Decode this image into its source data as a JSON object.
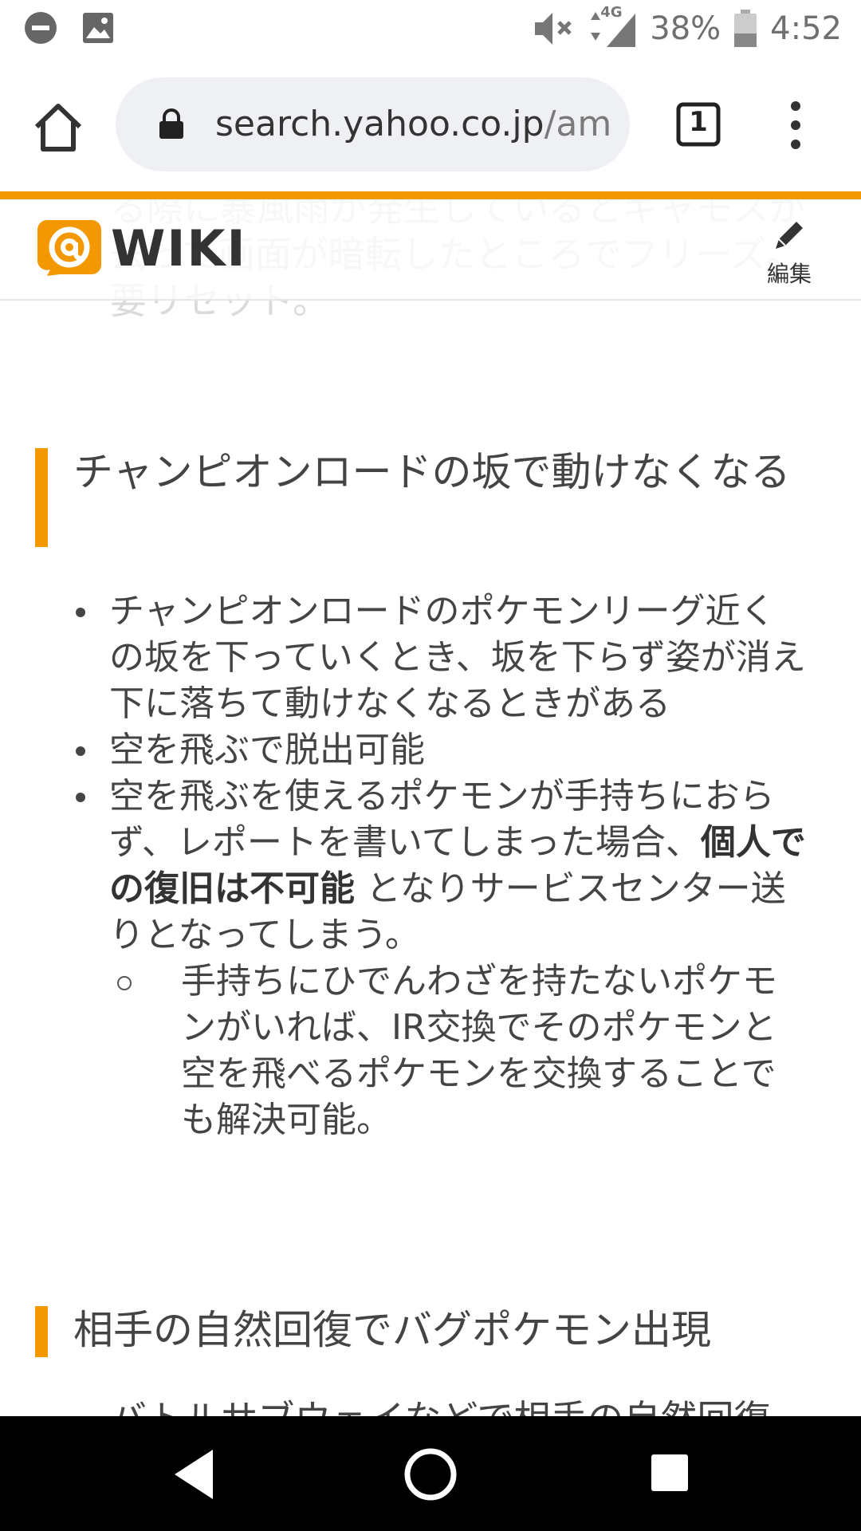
{
  "status_bar": {
    "battery": "38%",
    "time": "4:52",
    "network": "4G",
    "icons": [
      "dnd-icon",
      "image-icon",
      "mute-icon",
      "data-arrows-icon",
      "signal-icon",
      "battery-icon"
    ]
  },
  "browser": {
    "url_host": "search.yahoo.co.jp",
    "url_path": "/am",
    "tab_count": "1",
    "accent": "#f39800"
  },
  "site": {
    "logo_text": "WIKI",
    "edit_label": "編集",
    "ghost_text": "る際に暴風雨が発生しているとギャモスが去って画面が暗転したところでフリーズ。要リセット。"
  },
  "content": {
    "section1_title": "チャンピオンロードの坂で動けなくなる",
    "bullets": [
      "チャンピオンロードのポケモンリーグ近くの坂を下っていくとき、坂を下らず姿が消え下に落ちて動けなくなるときがある",
      "空を飛ぶで脱出可能"
    ],
    "bullet3_pre": "空を飛ぶを使えるポケモンが手持ちにおらず、レポートを書いてしまった場合、",
    "bullet3_bold": "個人での復旧は不可能",
    "bullet3_post": " となりサービスセンター送りとなってしまう。",
    "sub_bullet": "手持ちにひでんわざを持たないポケモンがいれば、IR交換でそのポケモンと空を飛べるポケモンを交換することでも解決可能。",
    "section2_title": "相手の自然回復でバグポケモン出現",
    "cut_text": "バトルサブウェイなどで相手の自然回復"
  }
}
